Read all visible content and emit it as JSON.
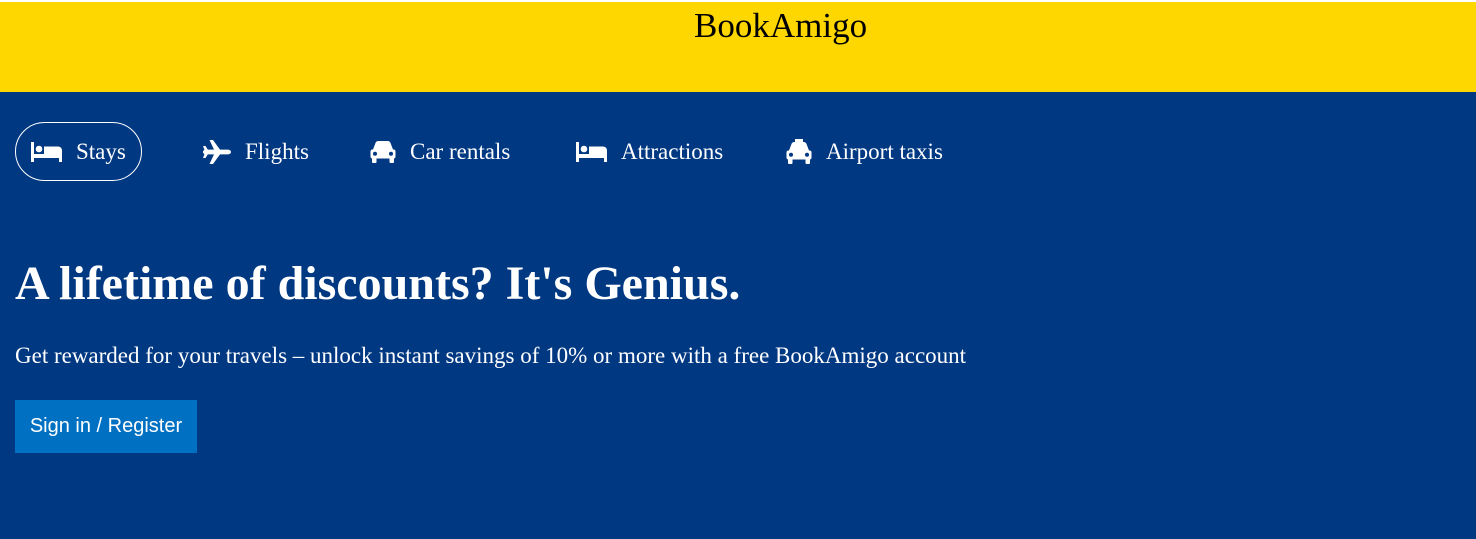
{
  "brand": {
    "name": "BookAmigo",
    "colors": {
      "bar": "#FFD700",
      "hero": "#003882",
      "cta": "#0071C2"
    }
  },
  "nav": {
    "items": [
      {
        "label": "Stays",
        "icon": "bed-icon",
        "active": true
      },
      {
        "label": "Flights",
        "icon": "plane-icon",
        "active": false
      },
      {
        "label": "Car rentals",
        "icon": "car-icon",
        "active": false
      },
      {
        "label": "Attractions",
        "icon": "bed-icon",
        "active": false
      },
      {
        "label": "Airport taxis",
        "icon": "taxi-icon",
        "active": false
      }
    ]
  },
  "hero": {
    "headline": "A lifetime of discounts? It's Genius.",
    "subline": "Get rewarded for your travels – unlock instant savings of 10% or more with a free BookAmigo account",
    "cta_label": "Sign in / Register"
  }
}
